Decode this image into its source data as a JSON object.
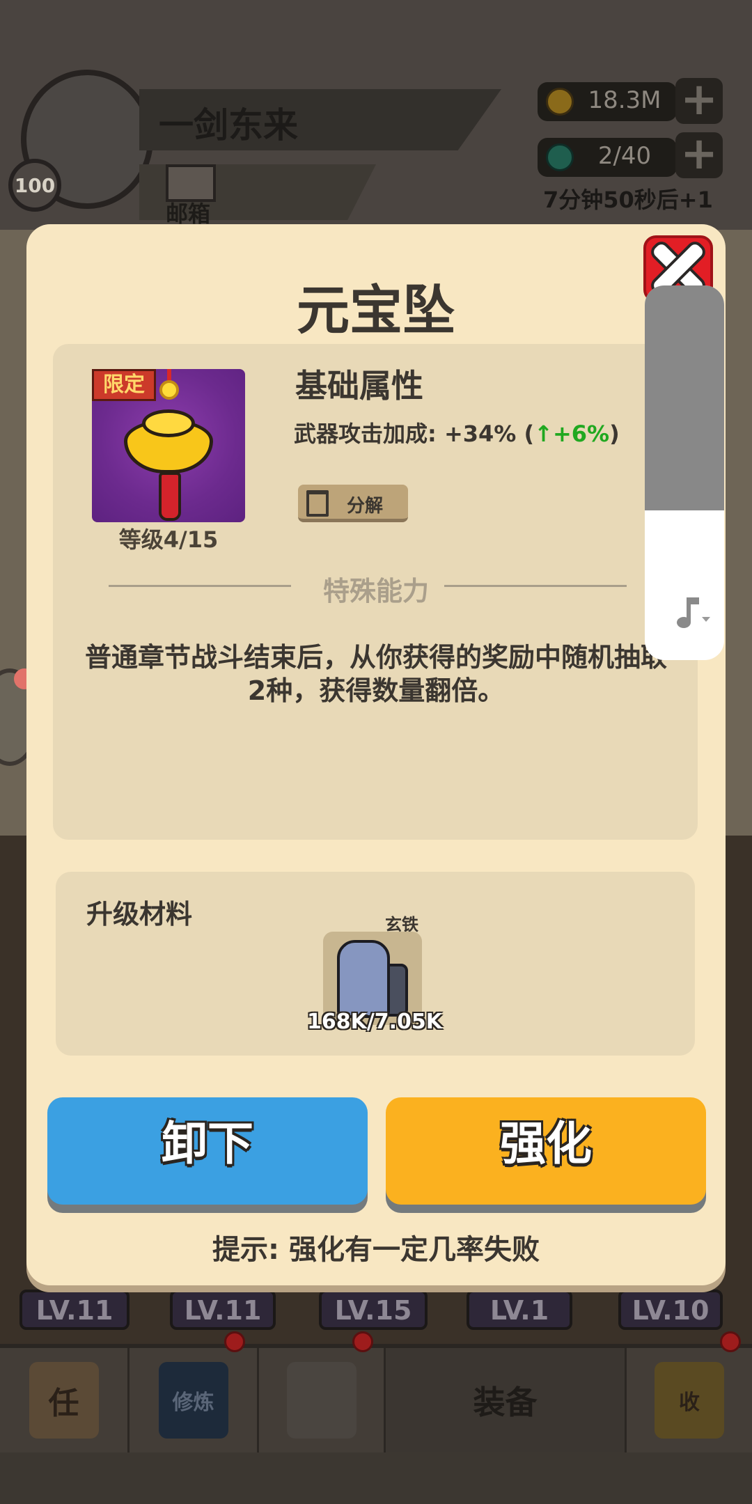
{
  "player": {
    "name": "一剑东来",
    "level": "100"
  },
  "mail": {
    "label": "邮箱"
  },
  "resources": {
    "gold": {
      "value": "18.3M",
      "plus": "+"
    },
    "energy": {
      "value": "2/40",
      "plus": "+"
    },
    "timer": "7分钟50秒后+1"
  },
  "background": {
    "level_tags": [
      "LV.11",
      "LV.11",
      "LV.15",
      "LV.1",
      "LV.10"
    ],
    "tabs": [
      {
        "label": "任",
        "icon": "task-scroll-icon"
      },
      {
        "label": "修炼",
        "icon": "cultivation-book-icon"
      },
      {
        "label": "",
        "icon": "crossed-swords-icon"
      },
      {
        "label": "装备",
        "icon": "helmet-icon"
      },
      {
        "label": "收",
        "icon": "collection-pavilion-icon"
      }
    ]
  },
  "dialog": {
    "title": "元宝坠",
    "item": {
      "tag": "限定",
      "level": "等级4/15",
      "icon": "gold-ingot-pendant-icon"
    },
    "base_attr": {
      "title": "基础属性",
      "stat": "武器攻击加成: +34% (",
      "delta": "↑+6%",
      "close_paren": ")"
    },
    "decompose_label": "分解",
    "special": {
      "title": "特殊能力",
      "description": "普通章节战斗结束后，从你获得的奖励中随机抽取2种，获得数量翻倍。"
    },
    "materials": {
      "title": "升级材料",
      "item_name": "玄铁",
      "count": "168K/7.05K"
    },
    "buttons": {
      "unequip": "卸下",
      "enhance": "强化"
    },
    "hint": "提示: 强化有一定几率失败",
    "colors": {
      "unequip": "#3ba0e2",
      "enhance": "#fbb11f",
      "close": "#e21e25",
      "delta": "#20a820"
    }
  },
  "volume": {
    "level": 0.4,
    "icon": "music-note-icon"
  }
}
